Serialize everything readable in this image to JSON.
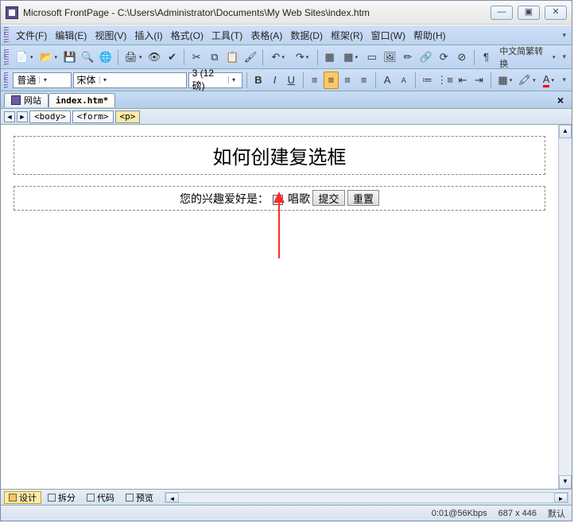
{
  "window": {
    "title": "Microsoft FrontPage - C:\\Users\\Administrator\\Documents\\My Web Sites\\index.htm"
  },
  "menu": {
    "file": "文件(F)",
    "edit": "编辑(E)",
    "view": "视图(V)",
    "insert": "插入(I)",
    "format": "格式(O)",
    "tools": "工具(T)",
    "table": "表格(A)",
    "data": "数据(D)",
    "frame": "框架(R)",
    "window": "窗口(W)",
    "help": "帮助(H)"
  },
  "toolbar": {
    "encoding": "中文简繁转换"
  },
  "format": {
    "style": "普通",
    "font": "宋体",
    "size": "3 (12 磅)"
  },
  "tabs": {
    "site": "网站",
    "file": "index.htm*"
  },
  "tagpath": {
    "body": "<body>",
    "form": "<form>",
    "p": "<p>"
  },
  "doc": {
    "heading": "如何创建复选框",
    "label": "您的兴趣爱好是：",
    "option": "唱歌",
    "submit": "提交",
    "reset": "重置"
  },
  "views": {
    "design": "设计",
    "split": "拆分",
    "code": "代码",
    "preview": "预览"
  },
  "status": {
    "speed": "0:01@56Kbps",
    "dims": "687 x 446",
    "mode": "默认"
  }
}
